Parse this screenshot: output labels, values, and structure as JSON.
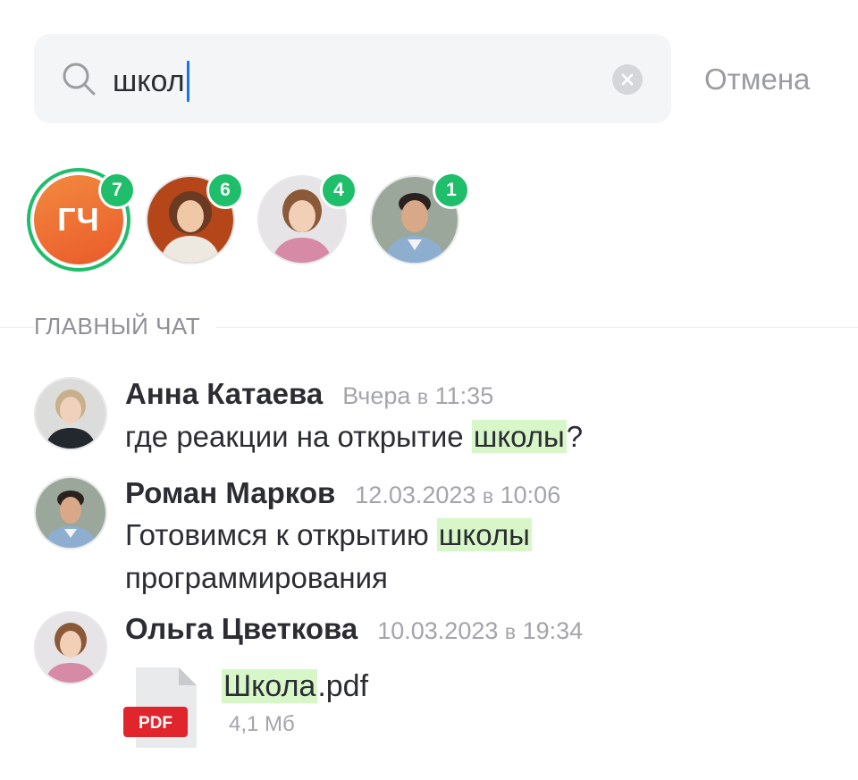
{
  "search": {
    "query": "школ",
    "cancel_label": "Отмена"
  },
  "stories": [
    {
      "initials": "ГЧ",
      "badge": "7"
    },
    {
      "badge": "6"
    },
    {
      "badge": "4"
    },
    {
      "badge": "1"
    }
  ],
  "section": {
    "title": "ГЛАВНЫЙ ЧАТ"
  },
  "messages": [
    {
      "author": "Анна Катаева",
      "time_main": "Вчера ",
      "time_sep": "в",
      "time_clock": " 11:35",
      "text_before": "где реакции на открытие ",
      "text_highlight": "школы",
      "text_after": "?"
    },
    {
      "author": "Роман Марков",
      "time_main": "12.03.2023 ",
      "time_sep": "в",
      "time_clock": " 10:06",
      "text_before": "Готовимся к открытию ",
      "text_highlight": "школы",
      "text_after": "программирования"
    },
    {
      "author": "Ольга Цветкова",
      "time_main": "10.03.2023 ",
      "time_sep": "в",
      "time_clock": " 19:34",
      "file": {
        "name_highlight": "Школа",
        "name_rest": ".pdf",
        "size": "4,1 Мб",
        "badge": "PDF"
      }
    }
  ],
  "colors": {
    "accent_green": "#1fbe6a",
    "highlight": "#d8f7c8",
    "caret": "#1a73e8",
    "pdf_red": "#e0262c"
  }
}
